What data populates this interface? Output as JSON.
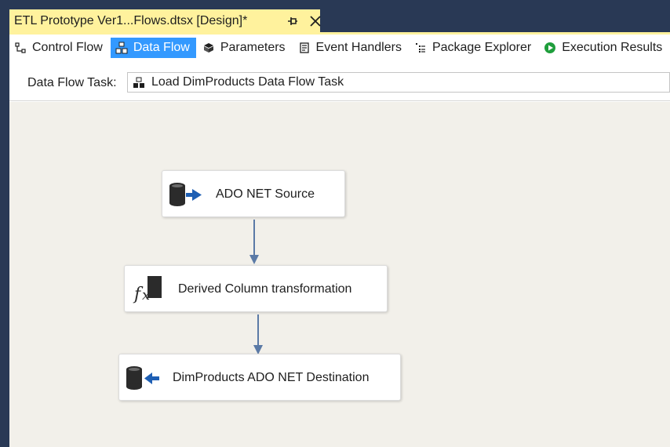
{
  "document_tab": {
    "title": "ETL Prototype Ver1...Flows.dtsx [Design]*",
    "pin_icon": "pin-icon",
    "close_icon": "close-icon"
  },
  "designer_tabs": [
    {
      "label": "Control Flow",
      "icon": "control-flow-icon",
      "active": false
    },
    {
      "label": "Data Flow",
      "icon": "data-flow-icon",
      "active": true
    },
    {
      "label": "Parameters",
      "icon": "parameters-icon",
      "active": false
    },
    {
      "label": "Event Handlers",
      "icon": "event-handlers-icon",
      "active": false
    },
    {
      "label": "Package Explorer",
      "icon": "package-explorer-icon",
      "active": false
    },
    {
      "label": "Execution Results",
      "icon": "execution-results-icon",
      "active": false
    }
  ],
  "task_selector": {
    "label": "Data Flow Task:",
    "value": "Load DimProducts Data Flow Task",
    "icon": "data-flow-task-icon"
  },
  "components": [
    {
      "label": "ADO NET Source",
      "icon": "ado-net-source-icon"
    },
    {
      "label": "Derived Column transformation",
      "icon": "derived-column-icon"
    },
    {
      "label": "DimProducts ADO NET Destination",
      "icon": "ado-net-destination-icon"
    }
  ],
  "colors": {
    "tab_highlight": "#fff29d",
    "active_tab": "#3399ff",
    "canvas": "#f2f0ea",
    "frame": "#293955",
    "connector": "#5b7aa6"
  }
}
